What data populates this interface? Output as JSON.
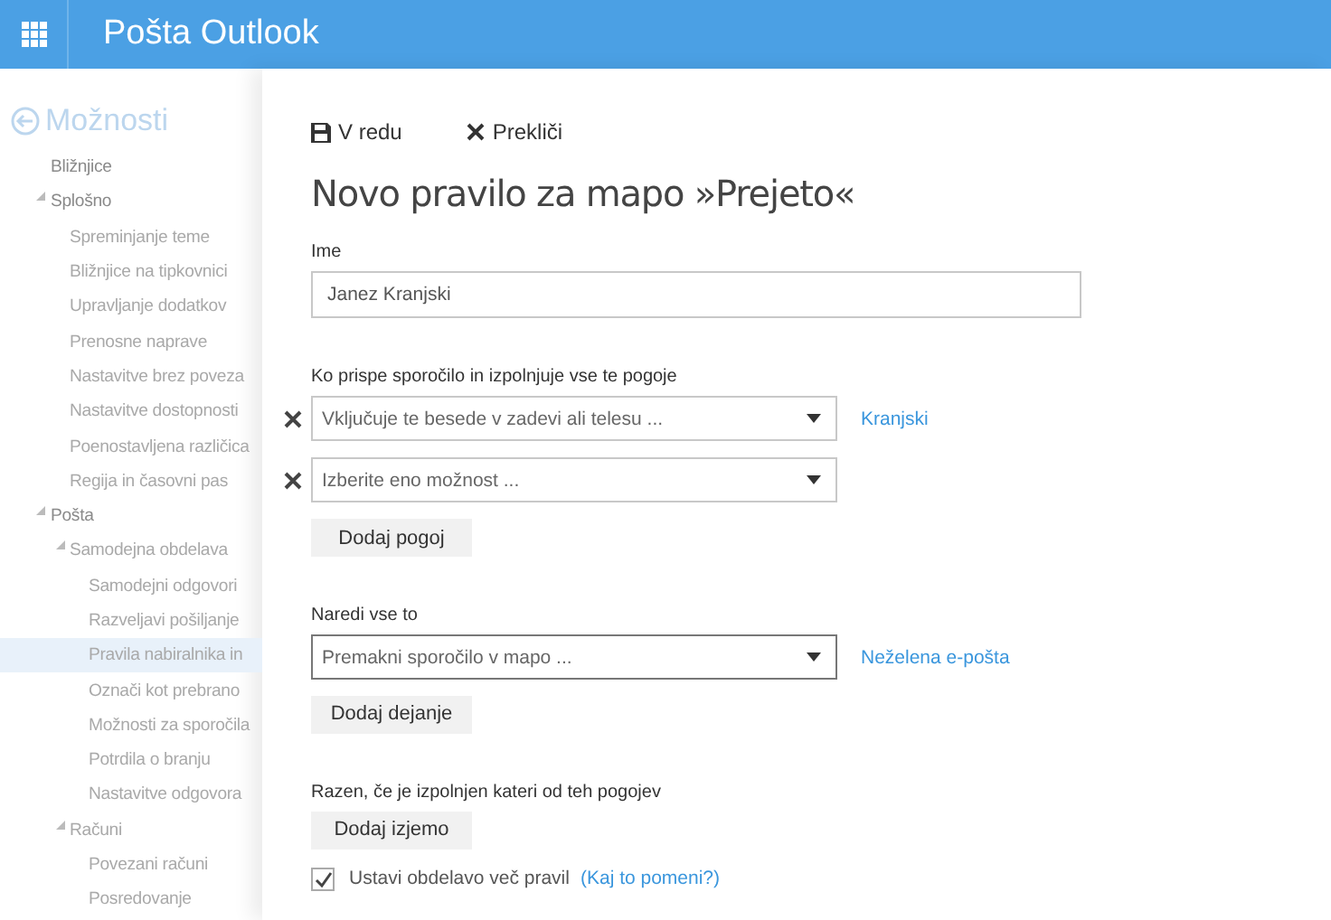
{
  "header": {
    "title": "Pošta Outlook"
  },
  "sidebar": {
    "title": "Možnosti",
    "items": [
      {
        "label": "Bližnjice",
        "selected": false
      },
      {
        "label": "Splošno",
        "expanded": true,
        "selected": false,
        "children": [
          {
            "label": "Spreminjanje teme",
            "selected": false
          },
          {
            "label": "Bližnjice na tipkovnici",
            "selected": false
          },
          {
            "label": "Upravljanje dodatkov",
            "selected": false
          },
          {
            "label": "Prenosne naprave",
            "selected": false
          },
          {
            "label": "Nastavitve brez poveza",
            "selected": false
          },
          {
            "label": "Nastavitve dostopnosti",
            "selected": false
          },
          {
            "label": "Poenostavljena različica",
            "selected": false
          },
          {
            "label": "Regija in časovni pas",
            "selected": false
          }
        ]
      },
      {
        "label": "Pošta",
        "expanded": true,
        "selected": false,
        "children": [
          {
            "label": "Samodejna obdelava",
            "expanded": true,
            "selected": false,
            "children": [
              {
                "label": "Samodejni odgovori",
                "selected": false
              },
              {
                "label": "Razveljavi pošiljanje",
                "selected": false
              },
              {
                "label": "Pravila nabiralnika in",
                "selected": true
              },
              {
                "label": "Označi kot prebrano",
                "selected": false
              },
              {
                "label": "Možnosti za sporočila",
                "selected": false
              },
              {
                "label": "Potrdila o branju",
                "selected": false
              },
              {
                "label": "Nastavitve odgovora",
                "selected": false
              }
            ]
          },
          {
            "label": "Računi",
            "expanded": true,
            "selected": false,
            "children": [
              {
                "label": "Povezani računi",
                "selected": false
              },
              {
                "label": "Posredovanje",
                "selected": false
              }
            ]
          }
        ]
      }
    ]
  },
  "toolbar": [
    {
      "label": "V redu",
      "kind": "save"
    },
    {
      "label": "Prekliči",
      "kind": "cancel"
    }
  ],
  "title": "Novo pravilo za mapo »Prejeto«",
  "name_field": {
    "label": "Ime",
    "value": "Janez Kranjski"
  },
  "conditions": {
    "label": "Ko prispe sporočilo in izpolnjuje vse te pogoje",
    "rows": [
      {
        "value": "Vključuje te besede v zadevi ali telesu ...",
        "link": "Kranjski",
        "focused": false
      },
      {
        "value": "Izberite eno možnost ...",
        "focused": false
      }
    ],
    "button": "Dodaj pogoj"
  },
  "actions": {
    "label": "Naredi vse to",
    "rows": [
      {
        "value": "Premakni sporočilo v mapo ...",
        "link": "Neželena e-pošta",
        "focused": true
      }
    ],
    "button": "Dodaj dejanje"
  },
  "exceptions": {
    "label": "Razen, če je izpolnjen kateri od teh pogojev",
    "button": "Dodaj izjemo"
  },
  "stop_processing": {
    "label": "Ustavi obdelavo več pravil",
    "checked": true,
    "link": "(Kaj to pomeni?)"
  }
}
